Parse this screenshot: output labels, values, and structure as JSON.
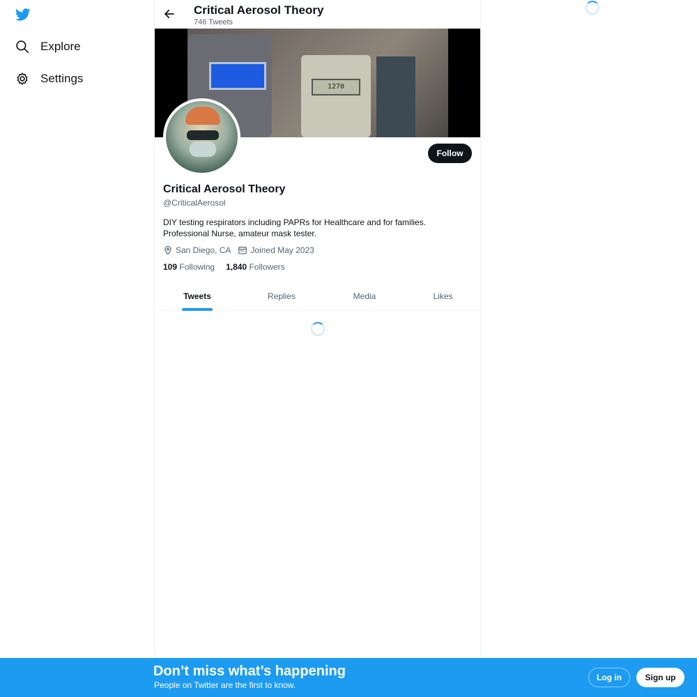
{
  "nav": {
    "logo_icon": "twitter-bird-icon",
    "items": [
      {
        "label": "Explore",
        "icon": "search-icon"
      },
      {
        "label": "Settings",
        "icon": "gear-icon"
      }
    ]
  },
  "header": {
    "title": "Critical Aerosol Theory",
    "subtitle": "746 Tweets",
    "back_icon": "back-arrow-icon"
  },
  "banner": {
    "display_reading": "1270"
  },
  "profile": {
    "name": "Critical Aerosol Theory",
    "handle": "@CriticalAerosol",
    "bio_line1": "DIY testing respirators including PAPRs for Healthcare and for families.",
    "bio_line2": "Professional Nurse, amateur mask tester.",
    "location": "San Diego, CA",
    "joined": "Joined May 2023",
    "following_count": "109",
    "following_label": "Following",
    "followers_count": "1,840",
    "followers_label": "Followers",
    "follow_button": "Follow"
  },
  "tabs": [
    {
      "label": "Tweets",
      "active": true
    },
    {
      "label": "Replies",
      "active": false
    },
    {
      "label": "Media",
      "active": false
    },
    {
      "label": "Likes",
      "active": false
    }
  ],
  "bottom_bar": {
    "title": "Don’t miss what’s happening",
    "subtitle": "People on Twitter are the first to know.",
    "login_label": "Log in",
    "signup_label": "Sign up"
  },
  "colors": {
    "accent": "#1d9bf0",
    "text_primary": "#0f1419",
    "text_secondary": "#536471",
    "border": "#eff3f4"
  }
}
